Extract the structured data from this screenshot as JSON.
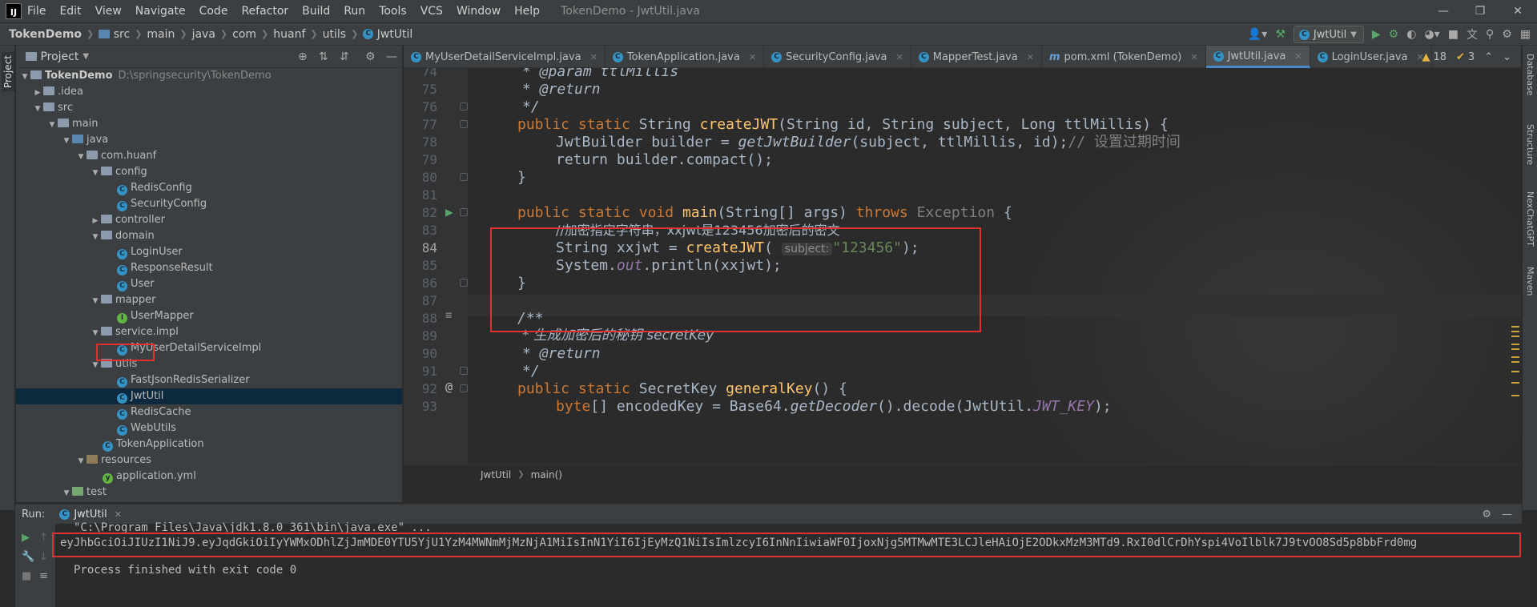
{
  "menubar": {
    "logo": "IJ",
    "items": [
      "File",
      "Edit",
      "View",
      "Navigate",
      "Code",
      "Refactor",
      "Build",
      "Run",
      "Tools",
      "VCS",
      "Window",
      "Help"
    ],
    "title": "TokenDemo - JwtUtil.java"
  },
  "breadcrumb": {
    "items": [
      "TokenDemo",
      "src",
      "main",
      "java",
      "com",
      "huanf",
      "utils",
      "JwtUtil"
    ]
  },
  "toolbar": {
    "run_config": "JwtUtil"
  },
  "project_panel": {
    "title": "Project",
    "tree": [
      {
        "label": "TokenDemo",
        "hint": "D:\\springsecurity\\TokenDemo"
      },
      {
        "label": ".idea"
      },
      {
        "label": "src"
      },
      {
        "label": "main"
      },
      {
        "label": "java"
      },
      {
        "label": "com.huanf"
      },
      {
        "label": "config"
      },
      {
        "label": "RedisConfig"
      },
      {
        "label": "SecurityConfig"
      },
      {
        "label": "controller"
      },
      {
        "label": "domain"
      },
      {
        "label": "LoginUser"
      },
      {
        "label": "ResponseResult"
      },
      {
        "label": "User"
      },
      {
        "label": "mapper"
      },
      {
        "label": "UserMapper"
      },
      {
        "label": "service.impl"
      },
      {
        "label": "MyUserDetailServiceImpl"
      },
      {
        "label": "utils"
      },
      {
        "label": "FastJsonRedisSerializer"
      },
      {
        "label": "JwtUtil"
      },
      {
        "label": "RedisCache"
      },
      {
        "label": "WebUtils"
      },
      {
        "label": "TokenApplication"
      },
      {
        "label": "resources"
      },
      {
        "label": "application.yml"
      },
      {
        "label": "test"
      }
    ]
  },
  "left_strip": {
    "project_label": "Project"
  },
  "right_strip": {
    "labels": [
      "Database",
      "Structure",
      "NexChatGPT",
      "Maven"
    ]
  },
  "editor": {
    "tabs": [
      {
        "label": "MyUserDetailServiceImpl.java"
      },
      {
        "label": "TokenApplication.java"
      },
      {
        "label": "SecurityConfig.java"
      },
      {
        "label": "MapperTest.java"
      },
      {
        "label": "pom.xml (TokenDemo)"
      },
      {
        "label": "JwtUtil.java",
        "active": true
      },
      {
        "label": "LoginUser.java"
      }
    ],
    "warnings": "18",
    "errors": "3",
    "lines": [
      {
        "no": "74",
        "text": "* @param ttlMillis"
      },
      {
        "no": "75",
        "text": "* @return"
      },
      {
        "no": "76",
        "text": "*/"
      },
      {
        "no": "77",
        "text": "public static String createJWT(String id, String subject, Long ttlMillis) {"
      },
      {
        "no": "78",
        "text": "JwtBuilder builder = getJwtBuilder(subject, ttlMillis, id);// 设置过期时间"
      },
      {
        "no": "79",
        "text": "return builder.compact();"
      },
      {
        "no": "80",
        "text": "}"
      },
      {
        "no": "81",
        "text": ""
      },
      {
        "no": "82",
        "text": "public static void main(String[] args) throws Exception {"
      },
      {
        "no": "83",
        "text": "//加密指定字符串，xxjwt是123456加密后的密文"
      },
      {
        "no": "84",
        "text": "String xxjwt = createJWT( subject: \"123456\");"
      },
      {
        "no": "85",
        "text": "System.out.println(xxjwt);"
      },
      {
        "no": "86",
        "text": "}"
      },
      {
        "no": "87",
        "text": ""
      },
      {
        "no": "88",
        "text": "/**"
      },
      {
        "no": "89",
        "text": "* 生成加密后的秘钥 secretKey"
      },
      {
        "no": "90",
        "text": "* @return"
      },
      {
        "no": "91",
        "text": "*/"
      },
      {
        "no": "92",
        "text": "public static SecretKey generalKey() {"
      },
      {
        "no": "93",
        "text": "byte[] encodedKey = Base64.getDecoder().decode(JwtUtil.JWT_KEY);"
      }
    ],
    "breadcrumb": [
      "JwtUtil",
      "main()"
    ]
  },
  "run_panel": {
    "label": "Run:",
    "tab": "JwtUtil",
    "console": {
      "cmd": "\"C:\\Program Files\\Java\\jdk1.8.0_361\\bin\\java.exe\" ...",
      "output": "eyJhbGciOiJIUzI1NiJ9.eyJqdGkiOiIyYWMxODhlZjJmMDE0YTU5YjU1YzM4MWNmMjMzNjA1MiIsInN1YiI6IjEyMzQ1NiIsImlzcyI6InNnIiwiaWF0IjoxNjg5MTMwMTE3LCJleHAiOjE2ODkxMzM3MTd9.RxI0dlCrDhYspi4VoIlblk7J9tvOO8Sd5p8bbFrd0mg",
      "exit": "Process finished with exit code 0"
    }
  },
  "colors": {
    "highlight_box": "#e03030",
    "keyword": "#cc7832",
    "function": "#ffc66d",
    "string": "#6a8759",
    "doc": "#629755"
  }
}
